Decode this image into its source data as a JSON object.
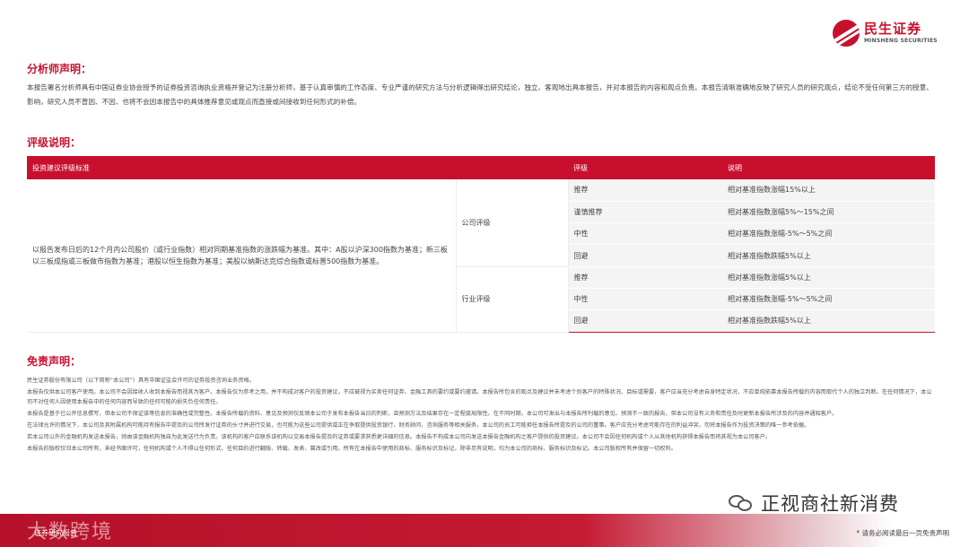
{
  "brand": {
    "name_cn": "民生证券",
    "name_en": "MINSHENG SECURITIES"
  },
  "analyst": {
    "title": "分析师声明：",
    "text": "本报告署名分析师具有中国证券业协会授予的证券投资咨询执业资格并登记为注册分析师，基于认真审慎的工作态度、专业严谨的研究方法与分析逻辑得出研究结论，独立、客观地出具本报告，并对本报告的内容和观点负责。本报告清晰准确地反映了研究人员的研究观点，结论不受任何第三方的授意、影响，研究人员不曾因、不因、也将不会因本报告中的具体推荐意见或观点而直接或间接收到任何形式的补偿。"
  },
  "rating": {
    "title": "评级说明：",
    "headers": [
      "投资建议评级标准",
      "",
      "评级",
      "说明"
    ],
    "standard": "以报告发布日后的12个月内公司股价（或行业指数）相对同期基准指数的涨跌幅为基准。其中：A股以沪深300指数为基准；新三板以三板成指或三板做市指数为基准；港股以恒生指数为基准；美股以纳斯达克综合指数或标普500指数为基准。",
    "company": {
      "label": "公司评级",
      "rows": [
        {
          "rating": "推荐",
          "desc": "相对基准指数涨幅15%以上"
        },
        {
          "rating": "谨慎推荐",
          "desc": "相对基准指数涨幅5%～15%之间"
        },
        {
          "rating": "中性",
          "desc": "相对基准指数涨幅-5%～5%之间"
        },
        {
          "rating": "回避",
          "desc": "相对基准指数跌幅5%以上"
        }
      ]
    },
    "industry": {
      "label": "行业评级",
      "rows": [
        {
          "rating": "推荐",
          "desc": "相对基准指数涨幅5%以上"
        },
        {
          "rating": "中性",
          "desc": "相对基准指数涨幅-5%～5%之间"
        },
        {
          "rating": "回避",
          "desc": "相对基准指数跌幅5%以上"
        }
      ]
    }
  },
  "disclaimer": {
    "title": "免责声明：",
    "paragraphs": [
      "民生证券股份有限公司（以下简称“本公司”）具有中国证监会许可的证券投资咨询业务资格。",
      "本报告仅供本公司客户使用。本公司不会因接收人收到本报告而视其为客户。本报告仅为参考之用，并不构成对客户的投资建议，不应被视为买卖任何证券、金融工具的要约或要约邀请。本报告所包含的观点及建议并未考虑个别客户的特殊状况、目标或需要，客户应当充分考虑自身特定状况，不应单纯依靠本报告所载的内容而取代个人的独立判断。在任何情况下，本公司不对任何人因使用本报告中的任何内容而导致的任何可能的损失负任何责任。",
      "本报告是基于已公开信息撰写，但本公司不保证该等信息的准确性或完整性。本报告所载的资料、意见及预测仅反映本公司于发布本报告当日的判断，且预测方法及结果存在一定程度局限性。在不同时期，本公司可发出与本报告所刊载的意见、预测不一致的报告，但本公司没有义务和责任及时更新本报告所涉及的内容并通知客户。",
      "在法律允许的情况下，本公司及其附属机构可能持有报告中提及的公司所发行证券的头寸并进行交易，也可能为这些公司提供或正在争取提供投资银行、财务顾问、咨询服务等相关服务，本公司的员工可能担任本报告所提及的公司的董事。客户应充分考虑可能存在的利益冲突，勿将本报告作为投资决策的唯一参考依据。",
      "若本公司以外的金融机构发送本报告，则由该金融机构独自为此发送行为负责。该机构的客户应联系该机构以交易本报告提及的证券或要求获悉更详细的信息。本报告不构成本公司向发送本报告金融机构之客户提供的投资建议。本公司不会因任何机构或个人从其他机构获得本报告而将其视为本公司客户。",
      "本报告的版权仅归本公司所有，未经书面许可，任何机构或个人不得以任何形式、任何目的进行翻版、转载、发表、篡改或引用。所有在本报告中使用的商标、服务标识及标记，除非另有说明，均为本公司的商标、服务标识及标记。本公司版权所有并保留一切权利。"
    ]
  },
  "footer": {
    "brand": "证券研究报告",
    "overlay": "大数跨境",
    "note": "* 请务必阅读最后一页免责声明"
  },
  "watermark": {
    "text": "正视商社新消费",
    "icon": "wechat-icon"
  }
}
